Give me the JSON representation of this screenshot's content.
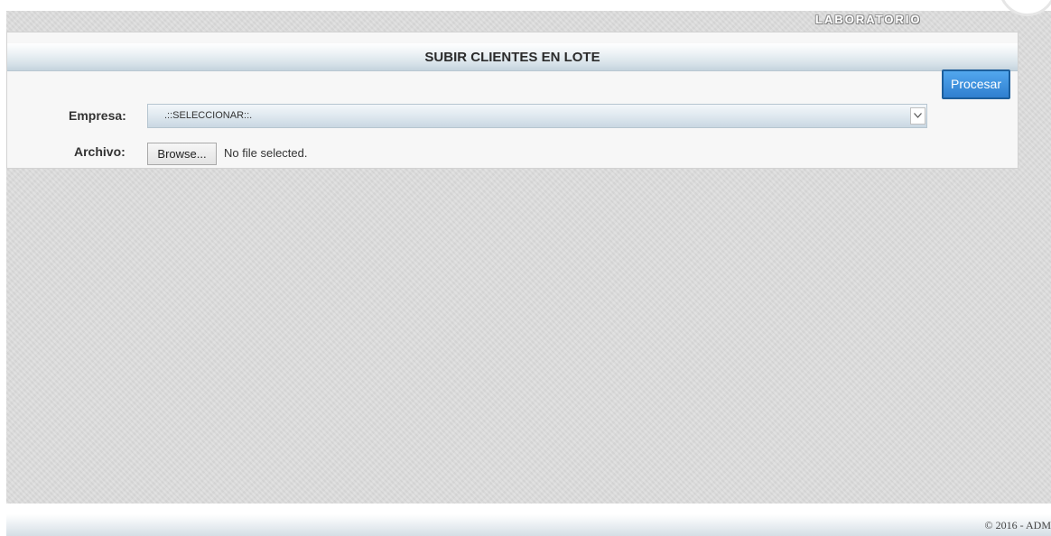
{
  "header": {
    "brand": "LABORATORIO"
  },
  "panel": {
    "title": "SUBIR CLIENTES EN LOTE",
    "process_button": "Procesar",
    "empresa": {
      "label": "Empresa:",
      "selected": ".::SELECCIONAR::."
    },
    "archivo": {
      "label": "Archivo:",
      "browse_label": "Browse...",
      "status": "No file selected."
    }
  },
  "footer": {
    "text": "© 2016 - ADM"
  },
  "icons": {
    "select_arrow": "chevron-down-icon"
  },
  "colors": {
    "accent": "#2f7fcf",
    "background": "#dcdcdc"
  }
}
